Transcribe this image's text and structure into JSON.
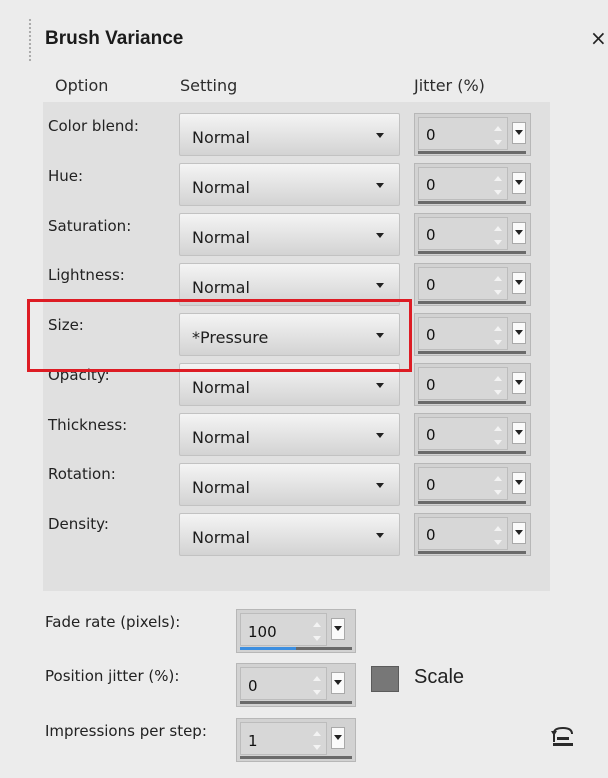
{
  "panel": {
    "title": "Brush Variance",
    "close_glyph": "×"
  },
  "headers": {
    "option": "Option",
    "setting": "Setting",
    "jitter": "Jitter (%)"
  },
  "rows": [
    {
      "label": "Color blend:",
      "setting": "Normal",
      "jitter": "0"
    },
    {
      "label": "Hue:",
      "setting": "Normal",
      "jitter": "0"
    },
    {
      "label": "Saturation:",
      "setting": "Normal",
      "jitter": "0"
    },
    {
      "label": "Lightness:",
      "setting": "Normal",
      "jitter": "0"
    },
    {
      "label": "Size:",
      "setting": "*Pressure",
      "jitter": "0"
    },
    {
      "label": "Opacity:",
      "setting": "Normal",
      "jitter": "0"
    },
    {
      "label": "Thickness:",
      "setting": "Normal",
      "jitter": "0"
    },
    {
      "label": "Rotation:",
      "setting": "Normal",
      "jitter": "0"
    },
    {
      "label": "Density:",
      "setting": "Normal",
      "jitter": "0"
    }
  ],
  "bottom": {
    "fade_rate_label": "Fade rate (pixels):",
    "fade_rate_value": "100",
    "fade_rate_fill_fraction": 0.5,
    "position_jitter_label": "Position jitter (%):",
    "position_jitter_value": "0",
    "scale_label": "Scale",
    "scale_checked": false,
    "impressions_label": "Impressions per step:",
    "impressions_value": "1"
  },
  "icons": {
    "close": "close-icon",
    "dropdown": "chevron-down-icon",
    "spinner": "spinner-arrows-icon",
    "reset": "reset-icon"
  },
  "colors": {
    "highlight": "#dd1c24",
    "fade_rate_bar": "#3d8fe0"
  }
}
